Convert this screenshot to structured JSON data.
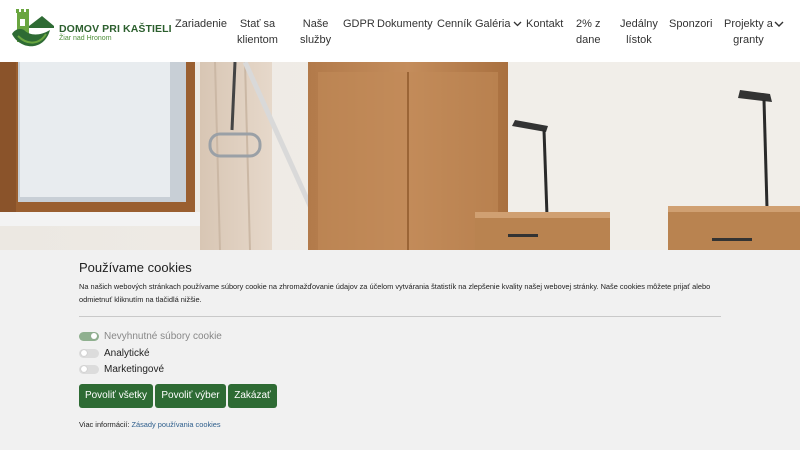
{
  "brand": {
    "title": "DOMOV PRI KAŠTIELI",
    "subtitle": "Žiar nad Hronom",
    "primary_color": "#2e6b34",
    "accent_color": "#6aa640"
  },
  "nav": {
    "items": [
      {
        "label": "Zariadenie"
      },
      {
        "label": "Stať sa",
        "label2": "klientom"
      },
      {
        "label": "Naše",
        "label2": "služby"
      },
      {
        "label": "GDPR"
      },
      {
        "label": "Dokumenty"
      },
      {
        "label": "Cenník"
      },
      {
        "label": "Galéria",
        "icon": "chevron-down-icon"
      },
      {
        "label": "Kontakt"
      },
      {
        "label": "2% z",
        "label2": "dane"
      },
      {
        "label": "Jedálny",
        "label2": "lístok"
      },
      {
        "label": "Sponzori"
      },
      {
        "label": "Projekty a",
        "label2": "granty",
        "icon": "chevron-down-icon"
      }
    ]
  },
  "cookie": {
    "title": "Používame cookies",
    "text": "Na našich webových stránkach používame súbory cookie na zhromažďovanie údajov za účelom vytvárania štatistík na zlepšenie kvality našej webovej stránky. Naše cookies môžete prijať alebo odmietnuť kliknutím na tlačidlá nižšie.",
    "options": [
      {
        "label": "Nevyhnutné súbory cookie",
        "checked": true,
        "disabled": true
      },
      {
        "label": "Analytické",
        "checked": false,
        "disabled": false
      },
      {
        "label": "Marketingové",
        "checked": false,
        "disabled": false
      }
    ],
    "buttons": {
      "allow_all": "Povoliť všetky",
      "allow_selection": "Povoliť výber",
      "deny": "Zakázať"
    },
    "more_label": "Viac informácií:",
    "more_link": "Zásady používania cookies"
  }
}
